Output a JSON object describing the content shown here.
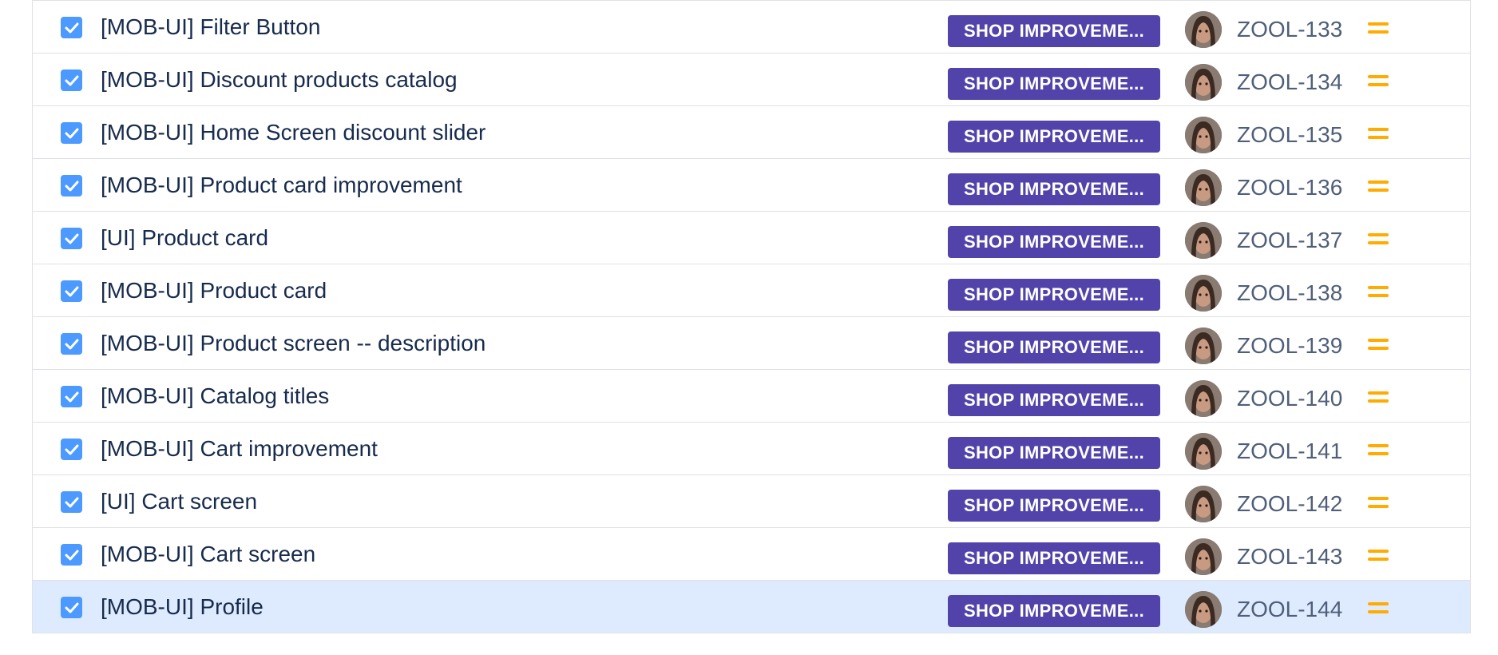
{
  "colors": {
    "epic": "#5243aa",
    "checkbox": "#4c9aff",
    "priority_medium": "#ffab00",
    "selected_row": "#deebff"
  },
  "rows": [
    {
      "summary": "[MOB-UI] Filter Button",
      "epic": "SHOP IMPROVEME...",
      "key": "ZOOL-133",
      "done": true,
      "priority": "medium-priority-icon",
      "selected": false
    },
    {
      "summary": "[MOB-UI] Discount products catalog",
      "epic": "SHOP IMPROVEME...",
      "key": "ZOOL-134",
      "done": true,
      "priority": "medium-priority-icon",
      "selected": false
    },
    {
      "summary": "[MOB-UI] Home Screen discount slider",
      "epic": "SHOP IMPROVEME...",
      "key": "ZOOL-135",
      "done": true,
      "priority": "medium-priority-icon",
      "selected": false
    },
    {
      "summary": "[MOB-UI] Product card improvement",
      "epic": "SHOP IMPROVEME...",
      "key": "ZOOL-136",
      "done": true,
      "priority": "medium-priority-icon",
      "selected": false
    },
    {
      "summary": "[UI] Product card",
      "epic": "SHOP IMPROVEME...",
      "key": "ZOOL-137",
      "done": true,
      "priority": "medium-priority-icon",
      "selected": false
    },
    {
      "summary": "[MOB-UI] Product card",
      "epic": "SHOP IMPROVEME...",
      "key": "ZOOL-138",
      "done": true,
      "priority": "medium-priority-icon",
      "selected": false
    },
    {
      "summary": "[MOB-UI] Product screen -- description",
      "epic": "SHOP IMPROVEME...",
      "key": "ZOOL-139",
      "done": true,
      "priority": "medium-priority-icon",
      "selected": false
    },
    {
      "summary": "[MOB-UI] Catalog titles",
      "epic": "SHOP IMPROVEME...",
      "key": "ZOOL-140",
      "done": true,
      "priority": "medium-priority-icon",
      "selected": false
    },
    {
      "summary": "[MOB-UI] Cart improvement",
      "epic": "SHOP IMPROVEME...",
      "key": "ZOOL-141",
      "done": true,
      "priority": "medium-priority-icon",
      "selected": false
    },
    {
      "summary": "[UI] Cart screen",
      "epic": "SHOP IMPROVEME...",
      "key": "ZOOL-142",
      "done": true,
      "priority": "medium-priority-icon",
      "selected": false
    },
    {
      "summary": "[MOB-UI] Cart screen",
      "epic": "SHOP IMPROVEME...",
      "key": "ZOOL-143",
      "done": true,
      "priority": "medium-priority-icon",
      "selected": false
    },
    {
      "summary": "[MOB-UI] Profile",
      "epic": "SHOP IMPROVEME...",
      "key": "ZOOL-144",
      "done": true,
      "priority": "medium-priority-icon",
      "selected": true
    }
  ]
}
